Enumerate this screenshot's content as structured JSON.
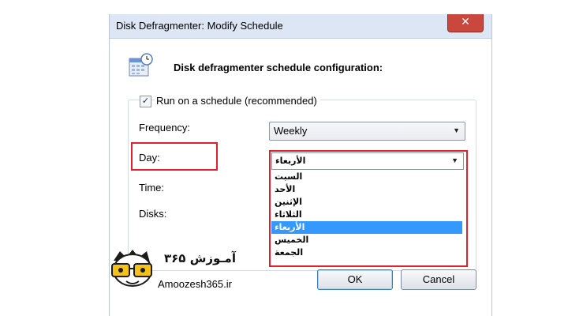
{
  "window": {
    "title": "Disk Defragmenter: Modify Schedule",
    "close_glyph": "✕"
  },
  "header": {
    "text": "Disk defragmenter schedule configuration:",
    "icon": "calendar-clock-icon"
  },
  "schedule": {
    "checkbox_label": "Run on a schedule (recommended)",
    "checked": true
  },
  "fields": {
    "frequency_label": "Frequency:",
    "frequency_value": "Weekly",
    "day_label": "Day:",
    "day_value": "الأربعاء",
    "time_label": "Time:",
    "disks_label": "Disks:"
  },
  "day_options": [
    "السبت",
    "الأحد",
    "الإثنين",
    "الثلاثاء",
    "الأربعاء",
    "الخميس",
    "الجمعة"
  ],
  "day_selected_index": 4,
  "buttons": {
    "ok": "OK",
    "cancel": "Cancel"
  },
  "watermark": {
    "site": "Amoozesh365.ir",
    "brand": "آمـوزش ۳۶۵"
  },
  "colors": {
    "highlight": "#e0202a",
    "selection": "#3399ff"
  }
}
